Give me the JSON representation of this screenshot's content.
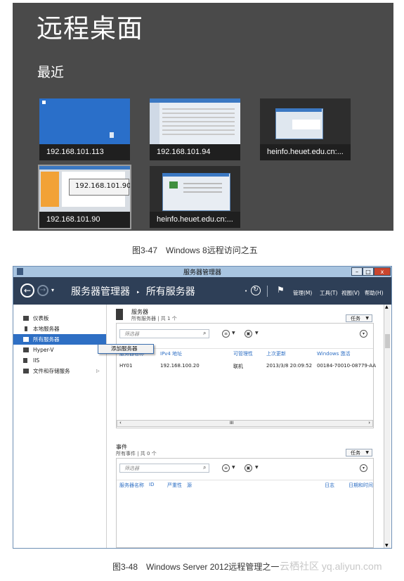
{
  "remote_desktop": {
    "title": "远程桌面",
    "recent_label": "最近",
    "tiles": [
      {
        "label": "192.168.101.113"
      },
      {
        "label": "192.168.101.94"
      },
      {
        "label": "heinfo.heuet.edu.cn:..."
      },
      {
        "label": "192.168.101.90",
        "tooltip": "192.168.101.90"
      },
      {
        "label": "heinfo.heuet.edu.cn:..."
      }
    ]
  },
  "caption1": "图3-47　Windows 8远程访问之五",
  "server_manager": {
    "window_title": "服务器管理器",
    "window_buttons": [
      "–",
      "□",
      "x"
    ],
    "breadcrumb_root": "服务器管理器",
    "breadcrumb_sep": "‣",
    "breadcrumb_current": "所有服务器",
    "menu": [
      "管理(M)",
      "工具(T)",
      "视图(V)",
      "帮助(H)"
    ],
    "sidebar": [
      {
        "label": "仪表板",
        "icon": "dashboard-icon"
      },
      {
        "label": "本地服务器",
        "icon": "server-icon"
      },
      {
        "label": "所有服务器",
        "icon": "servers-icon",
        "active": true
      },
      {
        "label": "Hyper-V",
        "icon": "hyperv-icon"
      },
      {
        "label": "IIS",
        "icon": "iis-icon"
      },
      {
        "label": "文件和存储服务",
        "icon": "storage-icon",
        "arrow": "▷"
      }
    ],
    "context_menu_item": "添加服务器",
    "servers_section": {
      "title": "服务器",
      "subtitle": "所有服务器 | 共 1 个",
      "task_label": "任务",
      "filter_placeholder": "筛选器",
      "columns": [
        "服务器名称",
        "IPv4 地址",
        "可管理性",
        "上次更新",
        "Windows 激活"
      ],
      "rows": [
        [
          "HY01",
          "192.168.100.20",
          "联机",
          "2013/3/8 20:09:52",
          "00184-70010-08779-AA"
        ]
      ],
      "hscroll_mark": "III"
    },
    "events_section": {
      "title": "事件",
      "subtitle": "所有事件 | 共 0 个",
      "task_label": "任务",
      "filter_placeholder": "筛选器",
      "columns": [
        "服务器名称",
        "ID",
        "严重性",
        "源",
        "日志",
        "日期和时间"
      ]
    }
  },
  "caption2": "图3-48　Windows Server 2012远程管理之一",
  "watermark": "云栖社区 yq.aliyun.com"
}
